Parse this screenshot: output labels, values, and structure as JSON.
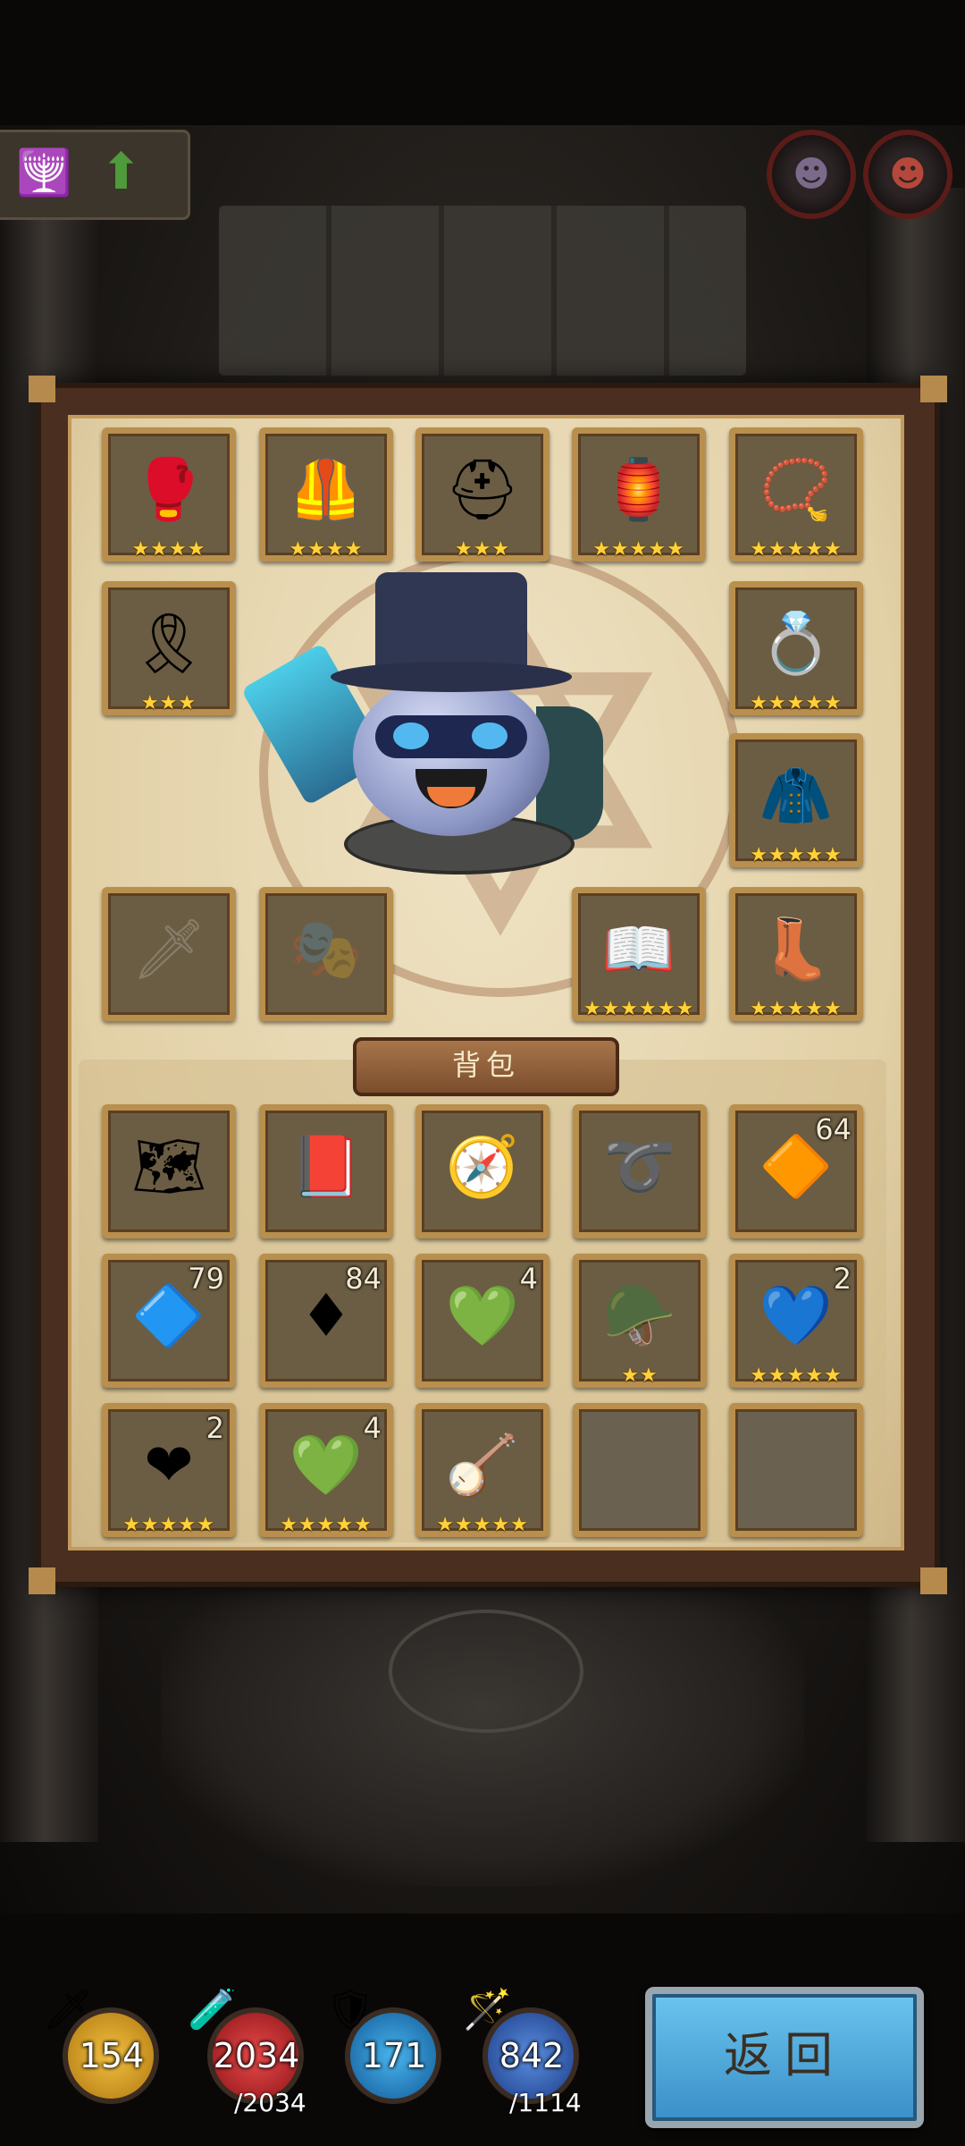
{
  "equipment": {
    "slots": [
      {
        "name": "bracer",
        "icon": "🥊",
        "stars": "★★★★"
      },
      {
        "name": "armor",
        "icon": "🦺",
        "stars": "★★★★"
      },
      {
        "name": "helmet",
        "icon": "⛑",
        "stars": "★★★"
      },
      {
        "name": "lantern",
        "icon": "🏮",
        "stars": "★★★★★"
      },
      {
        "name": "necklace",
        "icon": "📿",
        "stars": "★★★★★"
      },
      {
        "name": "belt",
        "icon": "🎗",
        "stars": "★★★"
      },
      {
        "name": "ring",
        "icon": "💍",
        "stars": "★★★★★"
      },
      {
        "name": "cloak",
        "icon": "🧥",
        "stars": "★★★★★"
      },
      {
        "name": "weapon",
        "icon": "🗡",
        "stars": ""
      },
      {
        "name": "mask",
        "icon": "🎭",
        "stars": ""
      },
      {
        "name": "book",
        "icon": "📖",
        "stars": "★★★★★★"
      },
      {
        "name": "boots",
        "icon": "👢",
        "stars": "★★★★★"
      }
    ]
  },
  "bag": {
    "title": "背包",
    "items": [
      {
        "name": "map",
        "icon": "🗺",
        "count": "",
        "stars": ""
      },
      {
        "name": "tome",
        "icon": "📕",
        "count": "",
        "stars": ""
      },
      {
        "name": "compass",
        "icon": "🧭",
        "count": "",
        "stars": ""
      },
      {
        "name": "rope",
        "icon": "➰",
        "count": "",
        "stars": ""
      },
      {
        "name": "orange-crystal",
        "icon": "🔶",
        "count": "64",
        "stars": ""
      },
      {
        "name": "blue-gem",
        "icon": "🔷",
        "count": "79",
        "stars": ""
      },
      {
        "name": "red-gem",
        "icon": "♦",
        "count": "84",
        "stars": ""
      },
      {
        "name": "green-gem",
        "icon": "💚",
        "count": "4",
        "stars": ""
      },
      {
        "name": "predator-helm",
        "icon": "🪖",
        "count": "",
        "stars": "★★"
      },
      {
        "name": "blue-heart",
        "icon": "💙",
        "count": "2",
        "stars": "★★★★★"
      },
      {
        "name": "red-heart",
        "icon": "❤",
        "count": "2",
        "stars": "★★★★★"
      },
      {
        "name": "green-heart",
        "icon": "💚",
        "count": "4",
        "stars": "★★★★★"
      },
      {
        "name": "harp",
        "icon": "🪕",
        "count": "",
        "stars": "★★★★★"
      },
      {
        "name": "empty",
        "icon": "",
        "count": "",
        "stars": ""
      },
      {
        "name": "empty",
        "icon": "",
        "count": "",
        "stars": ""
      }
    ]
  },
  "stats": {
    "attack": {
      "value": "154",
      "icon": "sword-icon",
      "color": "#d8a020"
    },
    "hp": {
      "value": "2034",
      "max": "/2034",
      "icon": "potion-icon",
      "color": "#c8242a"
    },
    "defense": {
      "value": "171",
      "icon": "shield-icon",
      "color": "#1e88c8"
    },
    "mana": {
      "value": "842",
      "max": "/1114",
      "icon": "staff-icon",
      "color": "#2e6ab8"
    }
  },
  "back_button": {
    "label": "返回"
  }
}
